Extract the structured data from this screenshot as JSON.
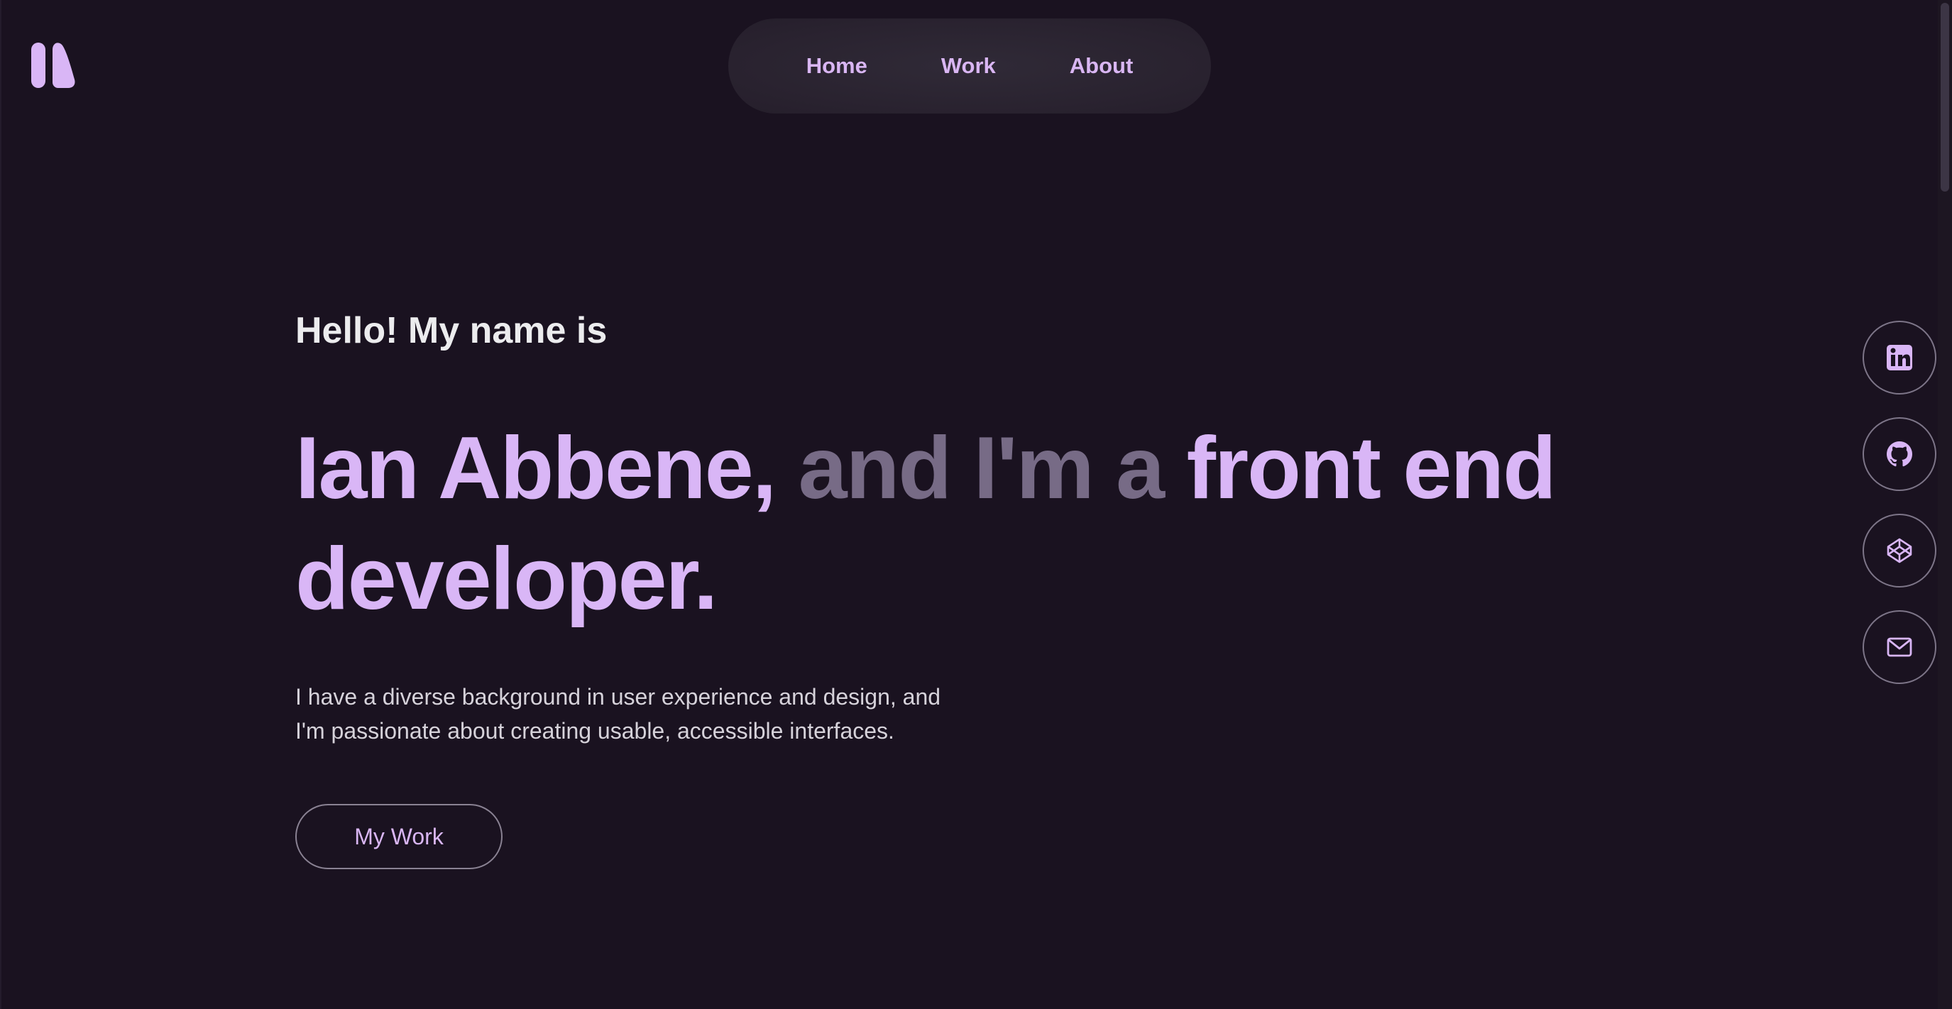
{
  "logo": {
    "icon": "ia-monogram-logo-icon",
    "color": "#d9b6f6"
  },
  "nav": {
    "items": [
      {
        "label": "Home"
      },
      {
        "label": "Work"
      },
      {
        "label": "About"
      }
    ]
  },
  "hero": {
    "greeting": "Hello! My name is",
    "headline": {
      "part1": "Ian Abbene,",
      "part2": "and I'm a",
      "part3": "front end developer."
    },
    "intro_line1": "I have a diverse background in user experience and design, and",
    "intro_line2": "I'm passionate about creating usable, accessible interfaces.",
    "cta_label": "My Work"
  },
  "social": [
    {
      "icon": "linkedin-icon"
    },
    {
      "icon": "github-icon"
    },
    {
      "icon": "codepen-icon"
    },
    {
      "icon": "mail-icon"
    }
  ],
  "colors": {
    "background": "#1a1220",
    "accent": "#d9b6f6",
    "muted": "#776b86",
    "text": "#ececee"
  }
}
